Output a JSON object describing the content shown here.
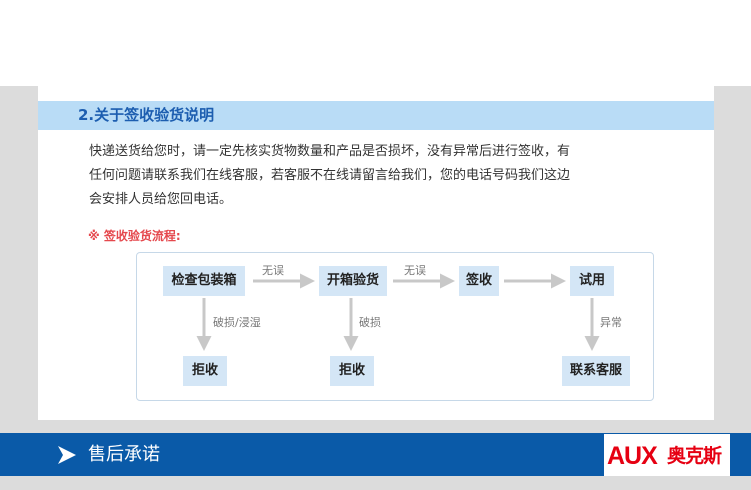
{
  "section": {
    "title": "2.关于签收验货说明",
    "description_lines": [
      "快递送货给您时，请一定先核实货物数量和产品是否损坏，没有异常后进行签收，有",
      "任何问题请联系我们在线客服，若客服不在线请留言给我们，您的电话号码我们这边",
      "会安排人员给您回电话。"
    ]
  },
  "flow": {
    "label": "※ 签收验货流程:",
    "nodes": {
      "inspect": "检查包装箱",
      "unbox": "开箱验货",
      "sign": "签收",
      "trial": "试用",
      "reject1": "拒收",
      "reject2": "拒收",
      "contact": "联系客服"
    },
    "edges": {
      "inspect_ok": "无误",
      "unbox_ok": "无误",
      "inspect_damaged": "破损/浸湿",
      "unbox_damaged": "破损",
      "trial_abnormal": "异常"
    }
  },
  "footer": {
    "title": "售后承诺",
    "logo_latin": "AUX",
    "logo_cn": "奥克斯"
  },
  "colors": {
    "section_bar": "#b9dcf6",
    "section_title": "#1d5eb0",
    "node_fill": "#d4e6f6",
    "arrow": "#c8c8c8",
    "flow_label": "#e5484d",
    "footer": "#0a5aa8",
    "brand": "#e60012"
  },
  "icons": {
    "footer": "chevron-arrow-icon"
  }
}
